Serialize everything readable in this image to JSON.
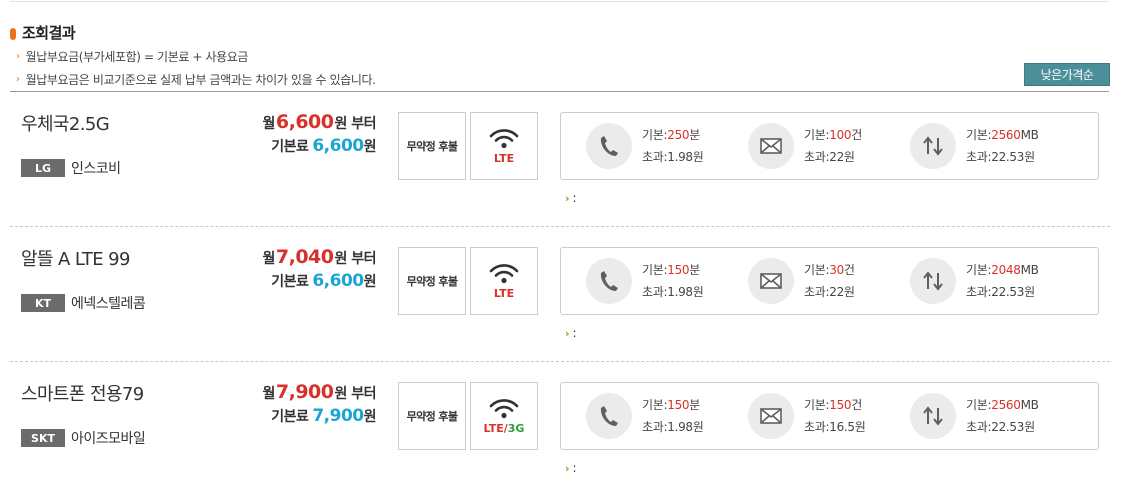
{
  "header": {
    "title": "조회결과",
    "notes": [
      "월납부요금(부가세포함) = 기본료 + 사용요금",
      "월납부요금은 비교기준으로 실제 납부 금액과는 차이가 있을 수 있습니다."
    ],
    "sort_button": "낮은가격순"
  },
  "labels": {
    "monthly_prefix": "월",
    "monthly_suffix": "원 부터",
    "base_prefix": "기본료",
    "won": "원",
    "voice_base": "기본:",
    "voice_unit": "분",
    "sms_base": "기본:",
    "sms_unit": "건",
    "data_base": "기본:",
    "data_unit": "MB",
    "over_prefix": "초과:",
    "more_marker": "›",
    "more_text": ":"
  },
  "plans": [
    {
      "name": "우체국2.5G",
      "carrier_code": "LG",
      "carrier_name": "인스코비",
      "monthly_price": "6,600",
      "base_fee": "6,600",
      "contract": "무약정 후불",
      "network": "LTE",
      "network_extra": "",
      "voice_base": "250",
      "voice_over": "1.98원",
      "sms_base": "100",
      "sms_over": "22원",
      "data_base": "2560",
      "data_over": "22.53원"
    },
    {
      "name": "알뜰 A LTE 99",
      "carrier_code": "KT",
      "carrier_name": "에넥스텔레콤",
      "monthly_price": "7,040",
      "base_fee": "6,600",
      "contract": "무약정 후불",
      "network": "LTE",
      "network_extra": "",
      "voice_base": "150",
      "voice_over": "1.98원",
      "sms_base": "30",
      "sms_over": "22원",
      "data_base": "2048",
      "data_over": "22.53원"
    },
    {
      "name": "스마트폰 전용79",
      "carrier_code": "SKT",
      "carrier_name": "아이즈모바일",
      "monthly_price": "7,900",
      "base_fee": "7,900",
      "contract": "무약정 후불",
      "network": "LTE",
      "network_extra": "3G",
      "voice_base": "150",
      "voice_over": "1.98원",
      "sms_base": "150",
      "sms_over": "16.5원",
      "data_base": "2560",
      "data_over": "22.53원"
    }
  ],
  "icons": {
    "title_mark": "bullet-icon",
    "note_arrow": "arrow-right-icon",
    "network": "wifi-icon",
    "voice": "phone-icon",
    "sms": "envelope-icon",
    "data": "data-transfer-icon"
  },
  "colors": {
    "accent_orange": "#e8731a",
    "price_red": "#d8312b",
    "base_blue": "#1aa6d4",
    "sort_button": "#4b8f98",
    "badge_gray": "#6b6b6b",
    "network_3g": "#2e9a3a"
  }
}
